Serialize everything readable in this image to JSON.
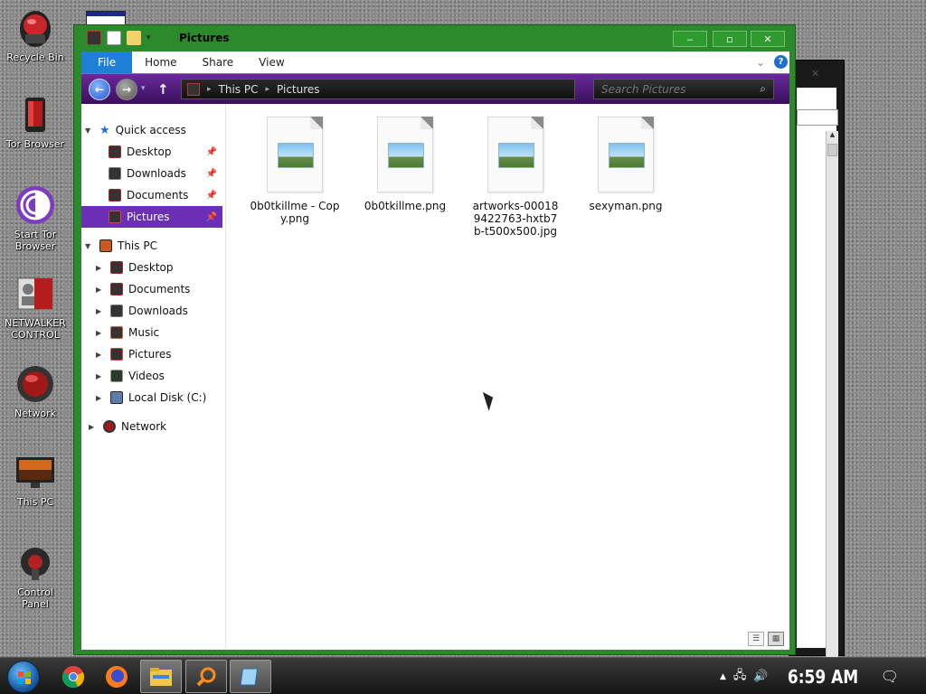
{
  "desktop": {
    "icons": [
      {
        "label": "Recycle Bin"
      },
      {
        "label": "Tor Browser"
      },
      {
        "label": "Start Tor Browser"
      },
      {
        "label": "NETWALKER CONTROL"
      },
      {
        "label": "Network"
      },
      {
        "label": "This PC"
      },
      {
        "label": "Control Panel"
      }
    ]
  },
  "window": {
    "title": "Pictures",
    "controls": {
      "minimize": "‒",
      "maximize": "▫",
      "close": "✕"
    }
  },
  "ribbon": {
    "tabs": [
      "File",
      "Home",
      "Share",
      "View"
    ],
    "expand_glyph": "⌄",
    "help_glyph": "?"
  },
  "address": {
    "crumbs": [
      "This PC",
      "Pictures"
    ],
    "separator": "▸",
    "search_placeholder": "Search Pictures"
  },
  "navpane": {
    "quick_access": {
      "label": "Quick access",
      "items": [
        {
          "label": "Desktop",
          "pinned": true
        },
        {
          "label": "Downloads",
          "pinned": true
        },
        {
          "label": "Documents",
          "pinned": true
        },
        {
          "label": "Pictures",
          "pinned": true,
          "selected": true
        }
      ]
    },
    "this_pc": {
      "label": "This PC",
      "items": [
        {
          "label": "Desktop"
        },
        {
          "label": "Documents"
        },
        {
          "label": "Downloads"
        },
        {
          "label": "Music"
        },
        {
          "label": "Pictures"
        },
        {
          "label": "Videos"
        },
        {
          "label": "Local Disk (C:)"
        }
      ]
    },
    "network": {
      "label": "Network"
    }
  },
  "files": [
    {
      "name": "0b0tkillme - Copy.png"
    },
    {
      "name": "0b0tkillme.png"
    },
    {
      "name": "artworks-000189422763-hxtb7b-t500x500.jpg"
    },
    {
      "name": "sexyman.png"
    }
  ],
  "taskbar": {
    "clock": "6:59 AM",
    "apps": [
      "chrome-icon",
      "firefox-icon",
      "file-explorer-icon",
      "search-icon",
      "notepad-icon"
    ]
  },
  "colors": {
    "window_frame": "#2c8a2c",
    "selection": "#6b2fb5",
    "file_tab": "#1f7fd6",
    "address_bar": "#4a1a72"
  }
}
